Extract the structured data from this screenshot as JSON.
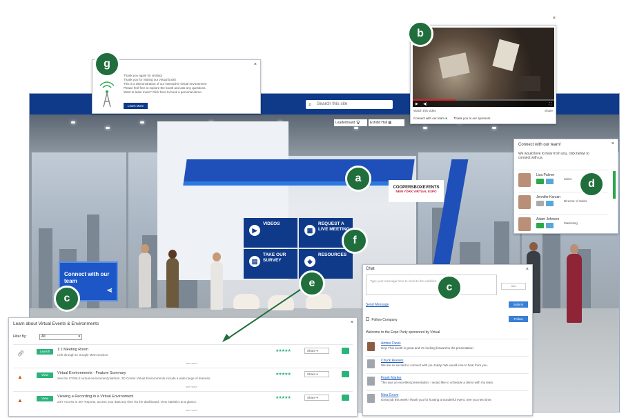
{
  "header": {
    "search_placeholder": "Search this site"
  },
  "top_links": {
    "leaderboard": "Leaderboard",
    "exhibit_hall": "Exhibit Hall"
  },
  "badges": [
    "a",
    "b",
    "c",
    "d",
    "e",
    "f",
    "g",
    "c"
  ],
  "booth": {
    "logo_main": "COOPERSBOXEVENTS",
    "logo_sub": "NEW YORK VIRTUAL EXPO",
    "tiles": [
      "VIDEOS",
      "REQUEST A LIVE MEETING",
      "TAKE OUR SURVEY",
      "RESOURCES"
    ],
    "connect_sign": "Connect with our team"
  },
  "announcement": {
    "lines": [
      "Thank you again for visiting!",
      "Thank you for visiting our virtual booth",
      "This is a demonstration of our interactive virtual environment",
      "Please feel free to explore the booth and ask any questions.",
      "Want to learn more? Click here to book a personal demo."
    ],
    "button": "Learn More"
  },
  "video_panel": {
    "meta_left": "Watch this video",
    "meta_right": "Share",
    "link_left": "Connect with our team",
    "link_right": "Thank you to our sponsors"
  },
  "team_panel": {
    "title": "Connect with our team!",
    "description": "We would love to hear from you, click below to connect with us.",
    "reps": [
      {
        "name": "Lisa Palmer",
        "title": "Sales"
      },
      {
        "name": "Jennifer Korzan",
        "title": "Director of Sales"
      },
      {
        "name": "Adam Johnson",
        "title": "Marketing"
      }
    ]
  },
  "chat": {
    "title": "Chat",
    "input_placeholder": "Type your message here to send to the exhibitor.",
    "input_aux": "Add",
    "link": "Send Message",
    "send": "Submit",
    "checkbox_label": "Follow Company",
    "follow": "Follow",
    "welcome": "Welcome to the Expo Party sponsored by Virtual",
    "messages": [
      {
        "name": "Amber Davis",
        "text": "Hey! This booth is great and I'm looking forward to the presentation."
      },
      {
        "name": "Chuck Reeves",
        "text": "We are so excited to connect with you today! We would love to hear from you."
      },
      {
        "name": "Frank Marker",
        "text": "This was an excellent presentation. I would like to schedule a demo with my team."
      },
      {
        "name": "Nina Grove",
        "text": "Great job this week! Thank you for hosting a wonderful event. See you next time."
      }
    ]
  },
  "resources": {
    "title": "Learn about Virtual Events & Environments",
    "filter_label": "Filter By:",
    "filter_value": "All",
    "rows": [
      {
        "pill": "Launch",
        "title": "1:1 Meeting Room",
        "desc": "Link through to Google Meet session",
        "more": "see more",
        "stars": "★★★★★",
        "select": "Share"
      },
      {
        "pill": "View",
        "title": "Virtual Environments - Feature Summary",
        "desc": "See the STABLE virtual environment platform. 3D Center Virtual Environments include a wide range of features.",
        "more": "see more",
        "stars": "★★★★★",
        "select": "Share"
      },
      {
        "pill": "View",
        "title": "Viewing a Recording in a Virtual Environment",
        "desc": "24/7 Access to 30+ Reports, access your data any time via the dashboard. View statistics at a glance.",
        "more": "see more",
        "stars": "★★★★★",
        "select": "Share"
      }
    ]
  },
  "colors": {
    "brand": "#0f3a8a",
    "badge": "#1f6e3c",
    "accent_green": "#2bb37a"
  }
}
